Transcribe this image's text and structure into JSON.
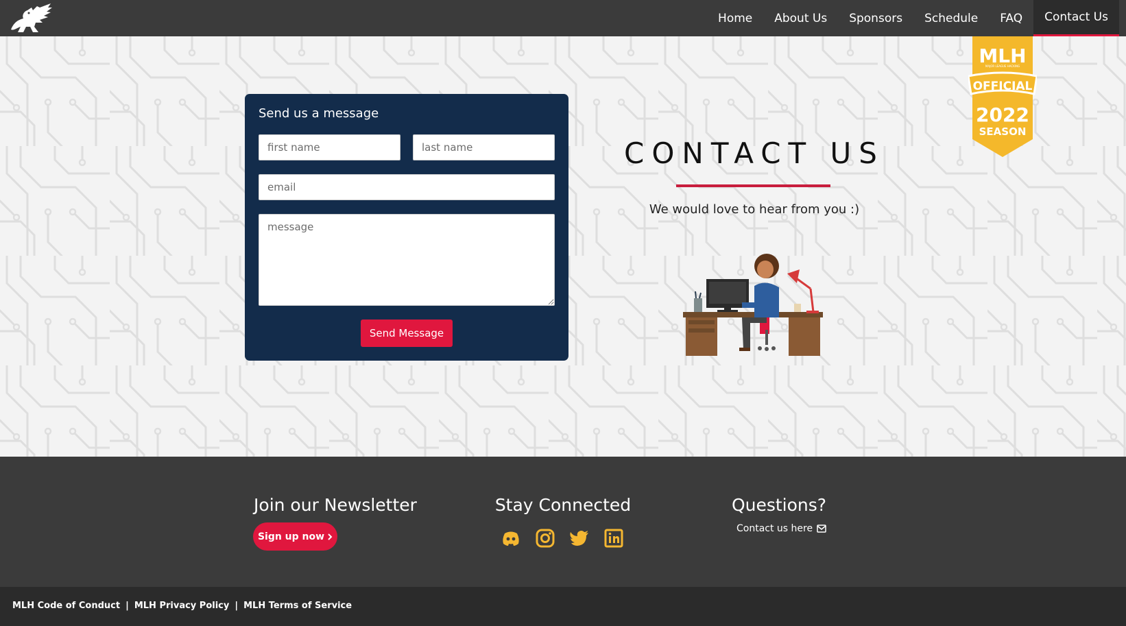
{
  "nav": {
    "items": [
      {
        "label": "Home"
      },
      {
        "label": "About Us"
      },
      {
        "label": "Sponsors"
      },
      {
        "label": "Schedule"
      },
      {
        "label": "FAQ"
      },
      {
        "label": "Contact Us",
        "active": true
      }
    ]
  },
  "badge": {
    "brand": "MLH",
    "tagline": "MAJOR LEAGUE HACKING",
    "ribbon": "OFFICIAL",
    "year": "2022",
    "season": "SEASON"
  },
  "form": {
    "title": "Send us a message",
    "first_name_placeholder": "first name",
    "last_name_placeholder": "last name",
    "email_placeholder": "email",
    "message_placeholder": "message",
    "submit_label": "Send Message"
  },
  "contact": {
    "title": "CONTACT US",
    "subtitle": "We would love to hear from you :)"
  },
  "footer": {
    "newsletter": {
      "heading": "Join our Newsletter",
      "button": "Sign up now"
    },
    "connected": {
      "heading": "Stay Connected",
      "icons": [
        "discord-icon",
        "instagram-icon",
        "twitter-icon",
        "linkedin-icon"
      ]
    },
    "questions": {
      "heading": "Questions?",
      "link": "Contact us here"
    }
  },
  "legal": {
    "code_of_conduct": "MLH Code of Conduct",
    "privacy": "MLH Privacy Policy",
    "terms": "MLH Terms of Service",
    "separator": "|"
  },
  "colors": {
    "nav_bg": "#3b3b3b",
    "form_bg": "#132c4b",
    "accent_red": "#e0173e",
    "badge_yellow": "#f4b82b",
    "social_yellow": "#f5b731"
  }
}
